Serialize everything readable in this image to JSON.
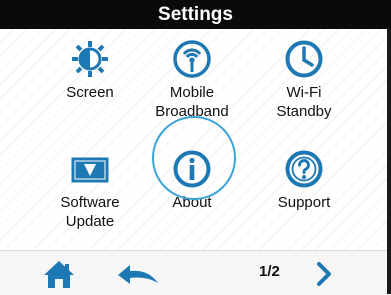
{
  "header": {
    "title": "Settings"
  },
  "tiles": [
    {
      "label": "Screen",
      "icon": "brightness-icon"
    },
    {
      "label": "Mobile\nBroadband",
      "icon": "antenna-icon"
    },
    {
      "label": "Wi-Fi\nStandby",
      "icon": "clock-icon"
    },
    {
      "label": "Software\nUpdate",
      "icon": "software-update-icon"
    },
    {
      "label": "About",
      "icon": "info-icon",
      "selected": true
    },
    {
      "label": "Support",
      "icon": "question-icon"
    }
  ],
  "footer": {
    "page_indicator": "1/2"
  },
  "colors": {
    "accent": "#1e78b4",
    "selection_ring": "#3aa3d8",
    "titlebar": "#0a0a0a"
  }
}
